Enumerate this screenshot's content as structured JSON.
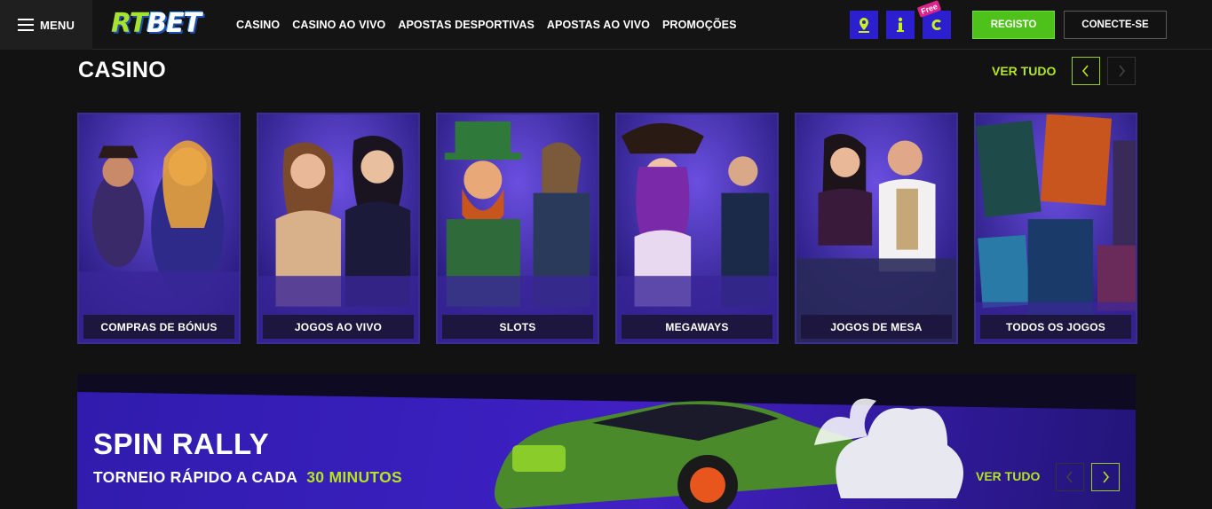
{
  "header": {
    "menu_label": "MENU",
    "logo": {
      "part1": "RT",
      "part2": "BET"
    },
    "nav": [
      "CASINO",
      "CASINO AO VIVO",
      "APOSTAS DESPORTIVAS",
      "APOSTAS AO VIVO",
      "PROMOÇÕES"
    ],
    "utility_icons": [
      "location-pin-icon",
      "info-icon",
      "coin-icon"
    ],
    "free_badge": "Free",
    "register_label": "REGISTO",
    "login_label": "CONECTE-SE"
  },
  "casino": {
    "title": "CASINO",
    "see_all": "VER TUDO",
    "categories": [
      {
        "label": "COMPRAS DE BÓNUS"
      },
      {
        "label": "JOGOS AO VIVO"
      },
      {
        "label": "SLOTS"
      },
      {
        "label": "MEGAWAYS"
      },
      {
        "label": "JOGOS DE MESA"
      },
      {
        "label": "TODOS OS JOGOS"
      }
    ]
  },
  "banner": {
    "title": "SPIN RALLY",
    "subtitle": "TORNEIO RÁPIDO A CADA",
    "highlight": "30 MINUTOS",
    "see_all": "VER TUDO"
  },
  "colors": {
    "accent_green": "#b5e61d",
    "register_green": "#4ec21b",
    "icon_blue": "#2b1fd0",
    "card_purple": "#2a1f86"
  }
}
